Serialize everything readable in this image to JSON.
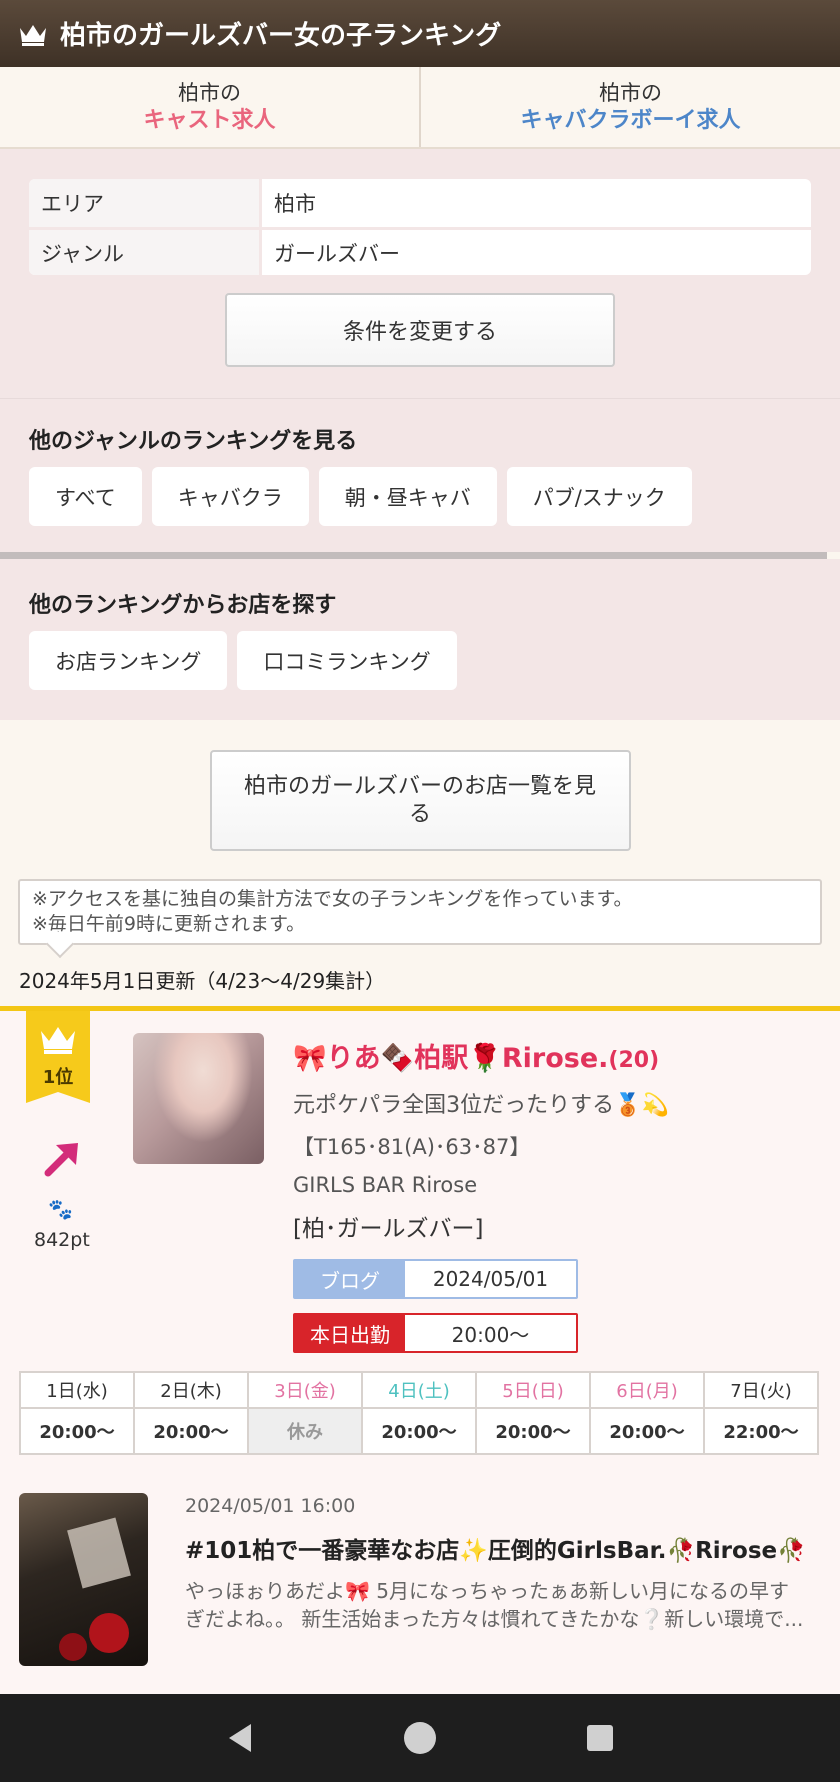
{
  "header": {
    "title": "柏市のガールズバー女の子ランキング"
  },
  "job_links": [
    {
      "prefix": "柏市の",
      "label": "キャスト求人",
      "color": "#e9657d"
    },
    {
      "prefix": "柏市の",
      "label": "キャバクラボーイ求人",
      "color": "#4d86c9"
    }
  ],
  "conditions": {
    "rows": [
      {
        "key": "エリア",
        "value": "柏市"
      },
      {
        "key": "ジャンル",
        "value": "ガールズバー"
      }
    ],
    "change_button": "条件を変更する"
  },
  "genre_section": {
    "title": "他のジャンルのランキングを見る",
    "chips": [
      "すべて",
      "キャバクラ",
      "朝・昼キャバ",
      "パブ/スナック"
    ]
  },
  "other_section": {
    "title": "他のランキングからお店を探す",
    "chips": [
      "お店ランキング",
      "口コミランキング"
    ]
  },
  "shop_list_button": "柏市のガールズバーのお店一覧を見る",
  "note": {
    "line1": "※アクセスを基に独自の集計方法で女の子ランキングを作っています。",
    "line2": "※毎日午前9時に更新されます。"
  },
  "updated_text": "2024年5月1日更新（4/23〜4/29集計）",
  "ranking": {
    "rank": "1位",
    "points": "842pt",
    "name": "🎀りあ🍫柏駅🌹Rirose.",
    "age": "(20)",
    "catchphrase": "元ポケパラ全国3位だったりする🥉💫",
    "spec": "【T165･81(A)･63･87】",
    "shop": "GIRLS BAR Rirose",
    "genre": "[柏･ガールズバー]",
    "blog_label": "ブログ",
    "blog_date": "2024/05/01",
    "today_label": "本日出勤",
    "today_time": "20:00〜",
    "schedule": [
      {
        "day": "1日(水)",
        "time": "20:00〜",
        "type": "normal"
      },
      {
        "day": "2日(木)",
        "time": "20:00〜",
        "type": "normal"
      },
      {
        "day": "3日(金)",
        "time": "休み",
        "type": "holiday-off"
      },
      {
        "day": "4日(土)",
        "time": "20:00〜",
        "type": "saturday"
      },
      {
        "day": "5日(日)",
        "time": "20:00〜",
        "type": "holiday"
      },
      {
        "day": "6日(月)",
        "time": "20:00〜",
        "type": "holiday"
      },
      {
        "day": "7日(火)",
        "time": "22:00〜",
        "type": "normal"
      }
    ],
    "blog_post": {
      "date": "2024/05/01 16:00",
      "title": "#101柏で一番豪華なお店✨圧倒的GirlsBar.🥀Rirose🥀",
      "body": "やっほぉりあだよ🎀 5月になっちゃったぁあ新しい月になるの早すぎだよね。。 新生活始まった方々は慣れてきたかな❔新しい環境で..."
    }
  },
  "colors": {
    "header_bg": "#4b3c2f",
    "accent_gold": "#f3c615",
    "name_pink": "#e1335b",
    "today_red": "#d8242a",
    "blog_blue": "#9fbbe5"
  }
}
